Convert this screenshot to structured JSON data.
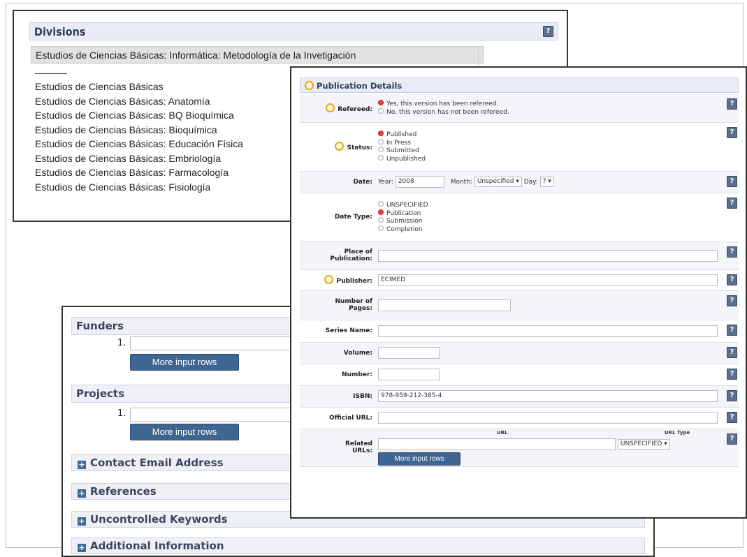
{
  "divisions": {
    "title": "Divisions",
    "selected": "Estudios de Ciencias Básicas: Informática: Metodología de la Invetigación",
    "items": [
      "Estudios de Ciencias Básicas",
      "Estudios de Ciencias Básicas: Anatomía",
      "Estudios de Ciencias Básicas: BQ Bioquímica",
      "Estudios de Ciencias Básicas: Bioquímica",
      "Estudios de Ciencias Básicas: Educación Física",
      "Estudios de Ciencias Básicas: Embriología",
      "Estudios de Ciencias Básicas: Farmacología",
      "Estudios de Ciencias Básicas: Fisiología"
    ]
  },
  "funders": {
    "title": "Funders",
    "row_number": "1.",
    "more_button": "More input rows"
  },
  "projects": {
    "title": "Projects",
    "row_number": "1.",
    "more_button": "More input rows"
  },
  "collapsed_sections": {
    "contact": "Contact Email Address",
    "references": "References",
    "keywords": "Uncontrolled Keywords",
    "additional": "Additional Information"
  },
  "publication": {
    "title": "Publication Details",
    "refereed": {
      "label": "Refereed:",
      "options": [
        "Yes, this version has been refereed.",
        "No, this version has not been refereed."
      ],
      "selected_index": 0
    },
    "status": {
      "label": "Status:",
      "options": [
        "Published",
        "In Press",
        "Submitted",
        "Unpublished"
      ],
      "selected_index": 0
    },
    "date": {
      "label": "Date:",
      "year_label": "Year:",
      "year_value": "2008",
      "month_label": "Month:",
      "month_value": "Unspecified",
      "day_label": "Day:",
      "day_value": "?"
    },
    "date_type": {
      "label": "Date Type:",
      "options": [
        "UNSPECIFIED",
        "Publication",
        "Submission",
        "Completion"
      ],
      "selected_index": 1
    },
    "place": {
      "label_line1": "Place of",
      "label_line2": "Publication:",
      "value": ""
    },
    "publisher": {
      "label": "Publisher:",
      "value": "ECIMED"
    },
    "pages": {
      "label_line1": "Number of",
      "label_line2": "Pages:",
      "value": ""
    },
    "series": {
      "label": "Series Name:",
      "value": ""
    },
    "volume": {
      "label": "Volume:",
      "value": ""
    },
    "number": {
      "label": "Number:",
      "value": ""
    },
    "isbn": {
      "label": "ISBN:",
      "value": "978-959-212-385-4"
    },
    "official_url": {
      "label": "Official URL:",
      "value": ""
    },
    "related_urls": {
      "label_line1": "Related",
      "label_line2": "URLs:",
      "col_url": "URL",
      "col_type": "URL Type",
      "type_value": "UNSPECIFIED",
      "more_button": "More input rows"
    }
  },
  "colors": {
    "accent": "#3f6591",
    "header_bg": "#e8ecf5",
    "required": "#e4a814",
    "radio_on": "#e34242"
  }
}
